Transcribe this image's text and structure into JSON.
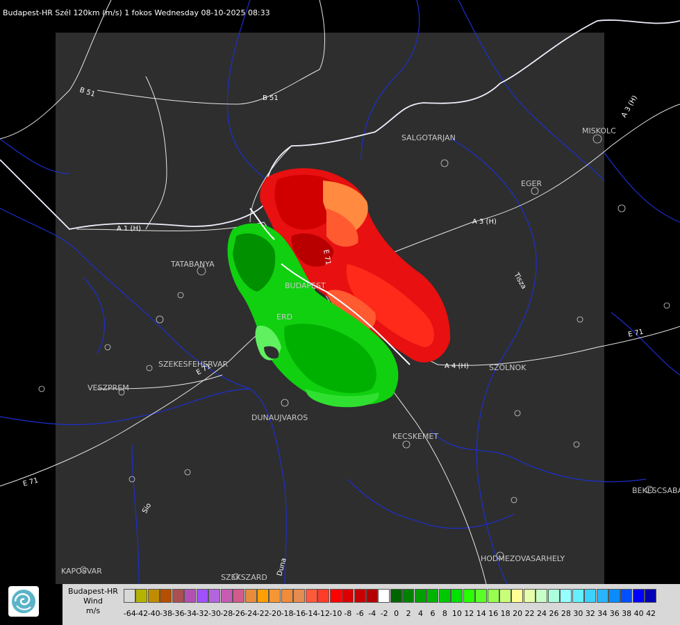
{
  "header": {
    "title": "Budapest-HR Szél 120km (m/s) 1 fokos Wednesday 08-10-2025 08:33"
  },
  "map": {
    "background_color": "#000000",
    "panel_color": "#2e2e2e",
    "road_color": "#ffffff",
    "river_border_color": "#1c2fd0",
    "cities": [
      "SALGOTARJAN",
      "MISKOLC",
      "EGER",
      "TATABANYA",
      "BUDAPEST",
      "ERD",
      "SZEKESFEHERVAR",
      "VESZPREM",
      "DUNAUJVAROS",
      "KECSKEMET",
      "SZOLNOK",
      "BEKESCSABA",
      "HODMEZOVASARHELY",
      "KAPOSVAR",
      "SZEKSZARD"
    ],
    "roads": [
      "B 51",
      "B 51",
      "A 1 (H)",
      "A 3 (H)",
      "A 3 (H)",
      "A 4 (H)",
      "E 71",
      "E 71",
      "E 71",
      "E 71"
    ],
    "rivers": [
      "Tisza",
      "Sio",
      "Duna"
    ],
    "radar_colors": {
      "receding": [
        "#d00000",
        "#e81010",
        "#ff2a1a",
        "#ff5a30",
        "#ff8a40"
      ],
      "approaching": [
        "#009000",
        "#00b000",
        "#10d010",
        "#30e030",
        "#60f060"
      ]
    }
  },
  "legend": {
    "station": "Budapest-HR",
    "quantity": "Wind",
    "unit": "m/s",
    "ticks": [
      "-64",
      "-42",
      "-40",
      "-38",
      "-36",
      "-34",
      "-32",
      "-30",
      "-28",
      "-26",
      "-24",
      "-22",
      "-20",
      "-18",
      "-16",
      "-14",
      "-12",
      "-10",
      "-8",
      "-6",
      "-4",
      "-2",
      "0",
      "2",
      "4",
      "6",
      "8",
      "10",
      "12",
      "14",
      "16",
      "18",
      "20",
      "22",
      "24",
      "26",
      "28",
      "30",
      "32",
      "34",
      "36",
      "38",
      "40",
      "42"
    ],
    "colors": [
      "#d8d8d8",
      "#b4b400",
      "#c08c00",
      "#b45000",
      "#aa5050",
      "#b450b4",
      "#a050ff",
      "#b464dc",
      "#c85ab4",
      "#d25a8c",
      "#e68c3c",
      "#ffa000",
      "#f59632",
      "#f08c3c",
      "#e68c50",
      "#ff5a3c",
      "#ff3c28",
      "#ff0000",
      "#dc0000",
      "#c80000",
      "#b40000",
      "#ffffff",
      "#006400",
      "#008200",
      "#00a000",
      "#00b400",
      "#00c800",
      "#00e100",
      "#28ff00",
      "#5aff28",
      "#96ff50",
      "#c8ff78",
      "#ffff96",
      "#e6ffaa",
      "#c8ffc8",
      "#aaffdc",
      "#96ffff",
      "#64f0ff",
      "#3cd2ff",
      "#28b4ff",
      "#0a8cff",
      "#0050ff",
      "#0000ff",
      "#0000b4"
    ]
  }
}
